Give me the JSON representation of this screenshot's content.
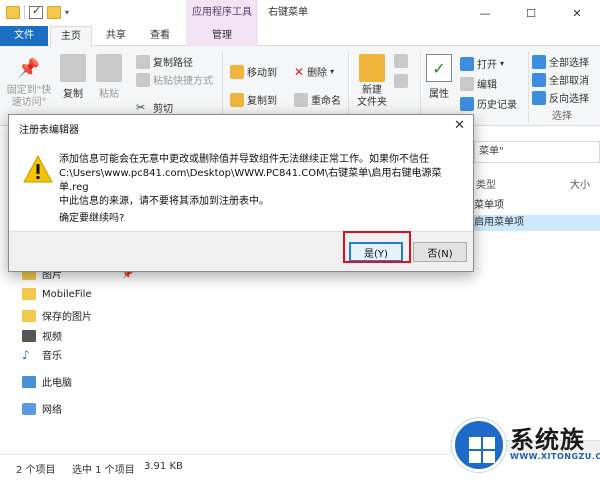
{
  "window": {
    "context_tab_title": "应用程序工具",
    "title": "右键菜单",
    "controls": [
      "—",
      "☐",
      "✕"
    ]
  },
  "tabs": {
    "file": "文件",
    "home": "主页",
    "share": "共享",
    "view": "查看",
    "manage": "管理"
  },
  "ribbon": {
    "pin_quick_access": "固定到\"快\n速访问\"",
    "copy": "复制",
    "paste": "粘贴",
    "copy_path": "复制路径",
    "paste_shortcut": "粘贴快捷方式",
    "cut": "剪切",
    "move_to": "移动到",
    "copy_to": "复制到",
    "delete": "删除",
    "rename": "重命名",
    "new_folder": "新建\n文件夹",
    "properties": "属性",
    "open": "打开",
    "edit": "编辑",
    "history": "历史记录",
    "select_all": "全部选择",
    "select_none": "全部取消",
    "invert_selection": "反向选择",
    "select_group_label": "选择"
  },
  "search": {
    "text": "菜单\""
  },
  "columns": {
    "type": "类型",
    "size": "大小"
  },
  "rows": [
    "菜单项",
    "启用菜单项"
  ],
  "nav": {
    "pictures": "图片",
    "mobilefile": "MobileFile",
    "saved_pictures": "保存的图片",
    "videos": "视频",
    "music": "音乐",
    "this_pc": "此电脑",
    "network": "网络"
  },
  "status": {
    "items": "2 个项目",
    "selected": "选中 1 个项目",
    "size": "3.91 KB"
  },
  "dialog": {
    "title": "注册表编辑器",
    "message_line1": "添加信息可能会在无意中更改或删除值并导致组件无法继续正常工作。如果你不信任",
    "message_line2": "C:\\Users\\www.pc841.com\\Desktop\\WWW.PC841.COM\\右键菜单\\启用右键电源菜单.reg",
    "message_line3": "中此信息的来源，请不要将其添加到注册表中。",
    "question": "确定要继续吗?",
    "yes": "是(Y)",
    "no": "否(N)"
  },
  "watermark": {
    "brand": "系统族",
    "url": "WWW.XITONGZU.COM"
  },
  "colors": {
    "accent": "#1a6fc3",
    "highlight_red": "#e0101e",
    "context_tab": "#f2e3f5"
  }
}
